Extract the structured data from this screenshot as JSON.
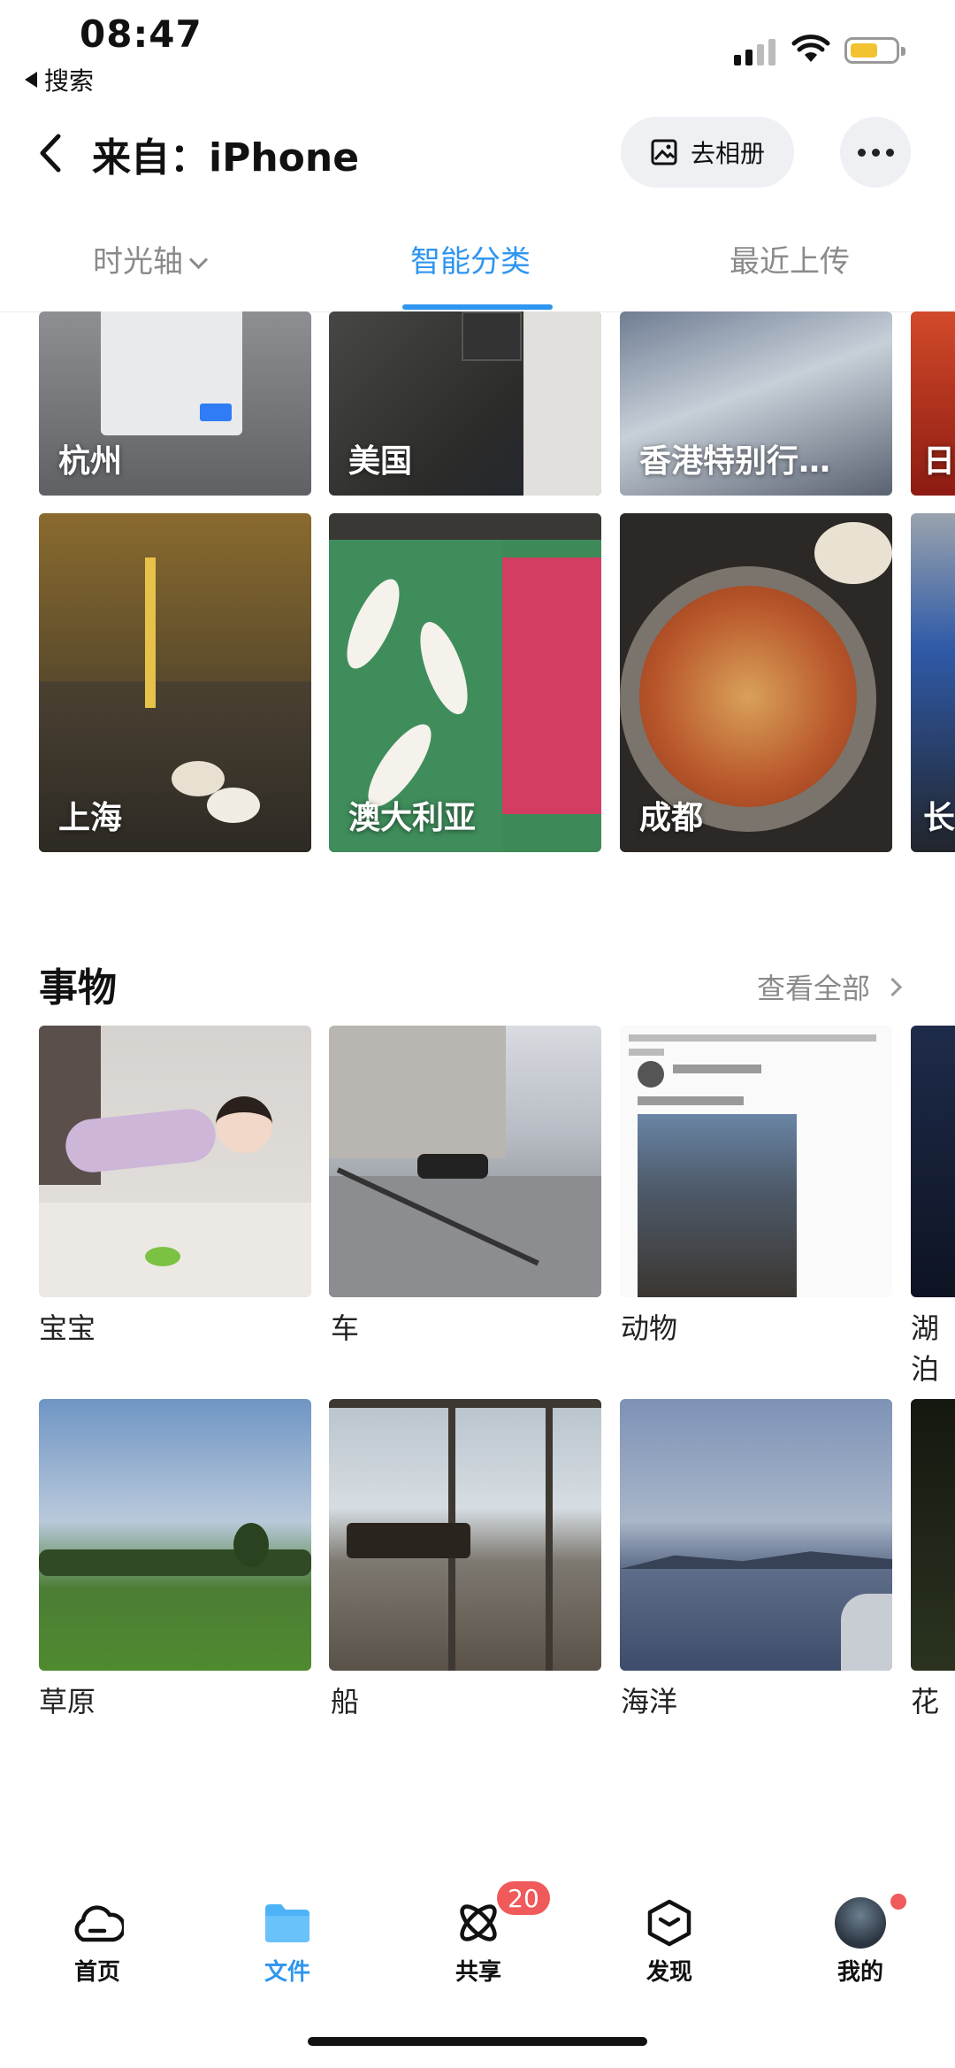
{
  "status_bar": {
    "time": "08:47",
    "back_app": "搜索"
  },
  "header": {
    "title": "来自：iPhone",
    "album_button": "去相册"
  },
  "tabs": [
    {
      "label": "时光轴",
      "active": false
    },
    {
      "label": "智能分类",
      "active": true
    },
    {
      "label": "最近上传",
      "active": false
    }
  ],
  "places_row1": [
    "杭州",
    "美国",
    "香港特别行…",
    "日"
  ],
  "places_row2": [
    "上海",
    "澳大利亚",
    "成都",
    "长"
  ],
  "things": {
    "title": "事物",
    "see_all": "查看全部",
    "row1": [
      "宝宝",
      "车",
      "动物",
      "湖泊"
    ],
    "row2": [
      "草原",
      "船",
      "海洋",
      "花"
    ]
  },
  "tab_bar": {
    "items": [
      {
        "label": "首页",
        "active": false
      },
      {
        "label": "文件",
        "active": true
      },
      {
        "label": "共享",
        "active": false
      },
      {
        "label": "发现",
        "active": false
      },
      {
        "label": "我的",
        "active": false
      }
    ],
    "share_badge": "20"
  },
  "colors": {
    "accent": "#2f95ef",
    "badge": "#f05a5a"
  }
}
